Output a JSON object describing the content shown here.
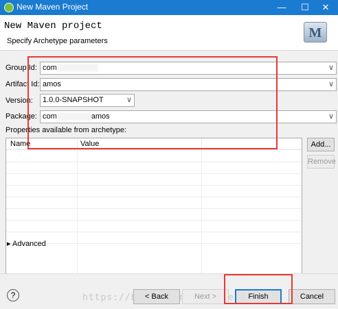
{
  "window": {
    "title": "New Maven Project",
    "minimize": "—",
    "maximize": "☐",
    "close": "✕"
  },
  "header": {
    "title": "New Maven project",
    "subtitle": "Specify Archetype parameters",
    "logo_letter": "M"
  },
  "form": {
    "group_id": {
      "label": "Group Id:",
      "value": "com"
    },
    "artifact_id": {
      "label": "Artifact Id:",
      "value": "amos"
    },
    "version": {
      "label": "Version:",
      "value": "1.0.0-SNAPSHOT"
    },
    "package": {
      "label": "Package:",
      "value_prefix": "com",
      "value_suffix": "amos"
    },
    "chevron": "∨"
  },
  "properties": {
    "label": "Properties available from archetype:",
    "columns": [
      "Name",
      "Value"
    ],
    "add_label": "Add...",
    "remove_label": "Remove"
  },
  "advanced": {
    "arrow": "▸",
    "label": "Advanced"
  },
  "footer": {
    "help": "?",
    "back": "< Back",
    "next": "Next >",
    "finish": "Finish",
    "cancel": "Cancel",
    "watermark": "https://blog.csdn.net/chencs0814s"
  }
}
